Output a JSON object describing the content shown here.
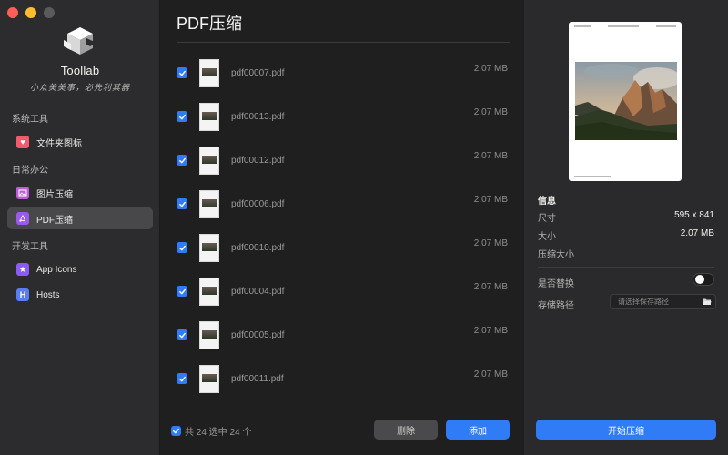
{
  "window": {
    "traffic_lights": [
      "close",
      "minimize",
      "maximize"
    ]
  },
  "brand": {
    "name": "Toollab",
    "tagline": "小众美美事，必先利其器"
  },
  "sidebar": {
    "sections": [
      {
        "title": "系统工具",
        "items": [
          {
            "label": "文件夹图标",
            "icon": "heart-folder-icon",
            "color": "#f05b6d",
            "active": false
          }
        ]
      },
      {
        "title": "日常办公",
        "items": [
          {
            "label": "图片压缩",
            "icon": "image-icon",
            "color": "#c05bd8",
            "active": false
          },
          {
            "label": "PDF压缩",
            "icon": "pdf-icon",
            "color": "#9b59f0",
            "active": true
          }
        ]
      },
      {
        "title": "开发工具",
        "items": [
          {
            "label": "App Icons",
            "icon": "app-icons-icon",
            "color": "#8a5cf5",
            "active": false
          },
          {
            "label": "Hosts",
            "icon": "hosts-icon",
            "color": "#5b7cf5",
            "active": false
          }
        ]
      }
    ]
  },
  "main": {
    "title": "PDF压缩",
    "files": [
      {
        "name": "pdf00007.pdf",
        "size": "2.07 MB",
        "checked": true
      },
      {
        "name": "pdf00013.pdf",
        "size": "2.07 MB",
        "checked": true
      },
      {
        "name": "pdf00012.pdf",
        "size": "2.07 MB",
        "checked": true
      },
      {
        "name": "pdf00006.pdf",
        "size": "2.07 MB",
        "checked": true
      },
      {
        "name": "pdf00010.pdf",
        "size": "2.07 MB",
        "checked": true
      },
      {
        "name": "pdf00004.pdf",
        "size": "2.07 MB",
        "checked": true
      },
      {
        "name": "pdf00005.pdf",
        "size": "2.07 MB",
        "checked": true
      },
      {
        "name": "pdf00011.pdf",
        "size": "2.07 MB",
        "checked": true
      }
    ],
    "footer": {
      "select_all_label": "共 24 选中 24 个",
      "delete_label": "删除",
      "add_label": "添加"
    }
  },
  "details": {
    "info_title": "信息",
    "dimensions_label": "尺寸",
    "dimensions_value": "595 x 841",
    "size_label": "大小",
    "size_value": "2.07 MB",
    "compressed_label": "压缩大小",
    "compressed_value": "",
    "replace_label": "是否替换",
    "replace_on": false,
    "path_label": "存储路径",
    "path_placeholder": "请选择保存路径",
    "path_value": "",
    "start_label": "开始压缩"
  },
  "colors": {
    "accent": "#2f7cf6",
    "sidebar_bg": "#2c2c2e",
    "main_bg": "#1f1f1f",
    "panel_bg": "#2a2a2c"
  }
}
